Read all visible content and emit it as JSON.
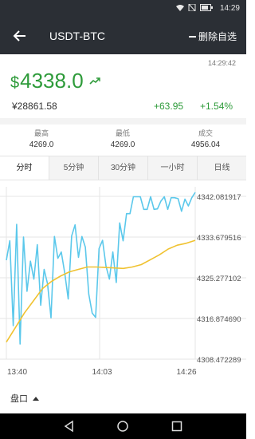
{
  "status_bar": {
    "time": "14:29"
  },
  "header": {
    "title": "USDT-BTC",
    "delete_label": "删除自选"
  },
  "quote": {
    "timestamp": "14:29:42",
    "currency_symbol": "$",
    "price": "4338.0",
    "cny_price": "¥28861.58",
    "change": "+63.95",
    "change_pct": "+1.54%",
    "accent": "#2e9b3a"
  },
  "stats": [
    {
      "label": "最高",
      "value": "4269.0"
    },
    {
      "label": "最低",
      "value": "4269.0"
    },
    {
      "label": "成交",
      "value": "4956.04"
    }
  ],
  "tabs": [
    "分时",
    "5分钟",
    "30分钟",
    "一小时",
    "日线"
  ],
  "active_tab": "分时",
  "chart_data": {
    "type": "line",
    "y_ticks": [
      "4342.081917",
      "4333.679516",
      "4325.277102",
      "4316.874690",
      "4308.472289"
    ],
    "x_ticks": [
      "13:40",
      "14:03",
      "14:26"
    ],
    "ylim": [
      4308.472289,
      4342.081917
    ],
    "grid": true,
    "series": [
      {
        "color": "#5bc8eb",
        "values": [
          4328.9,
          4332.9,
          4315.4,
          4336.3,
          4311.6,
          4333.7,
          4322.5,
          4328.7,
          4325.0,
          4332.1,
          4319.6,
          4327.0,
          4324.0,
          4317.0,
          4333.8,
          4329.3,
          4330.6,
          4326.2,
          4320.9,
          4333.9,
          4336.2,
          4329.5,
          4333.8,
          4331.6,
          4321.9,
          4318.0,
          4317.1,
          4331.3,
          4333.0,
          4327.7,
          4325.0,
          4330.6,
          4324.3,
          4336.6,
          4332.9,
          4338.5,
          4338.5,
          4342.0,
          4342.0,
          4342.0,
          4339.4,
          4339.4,
          4342.0,
          4339.4,
          4339.5,
          4341.1,
          4342.0,
          4339.4,
          4341.8,
          4341.8,
          4341.6,
          4339.0,
          4341.5,
          4340.1,
          4341.8,
          4342.9
        ]
      },
      {
        "color": "#f0c230",
        "values": [
          4312.0,
          4315.0,
          4318.0,
          4320.5,
          4323.0,
          4324.5,
          4325.6,
          4326.5,
          4327.0,
          4327.5,
          4327.5,
          4327.4,
          4327.3,
          4327.2,
          4327.5,
          4328.0,
          4329.0,
          4330.0,
          4331.2,
          4332.0,
          4332.4,
          4333.0
        ]
      }
    ]
  },
  "bottom": {
    "pankou_label": "盘口"
  }
}
